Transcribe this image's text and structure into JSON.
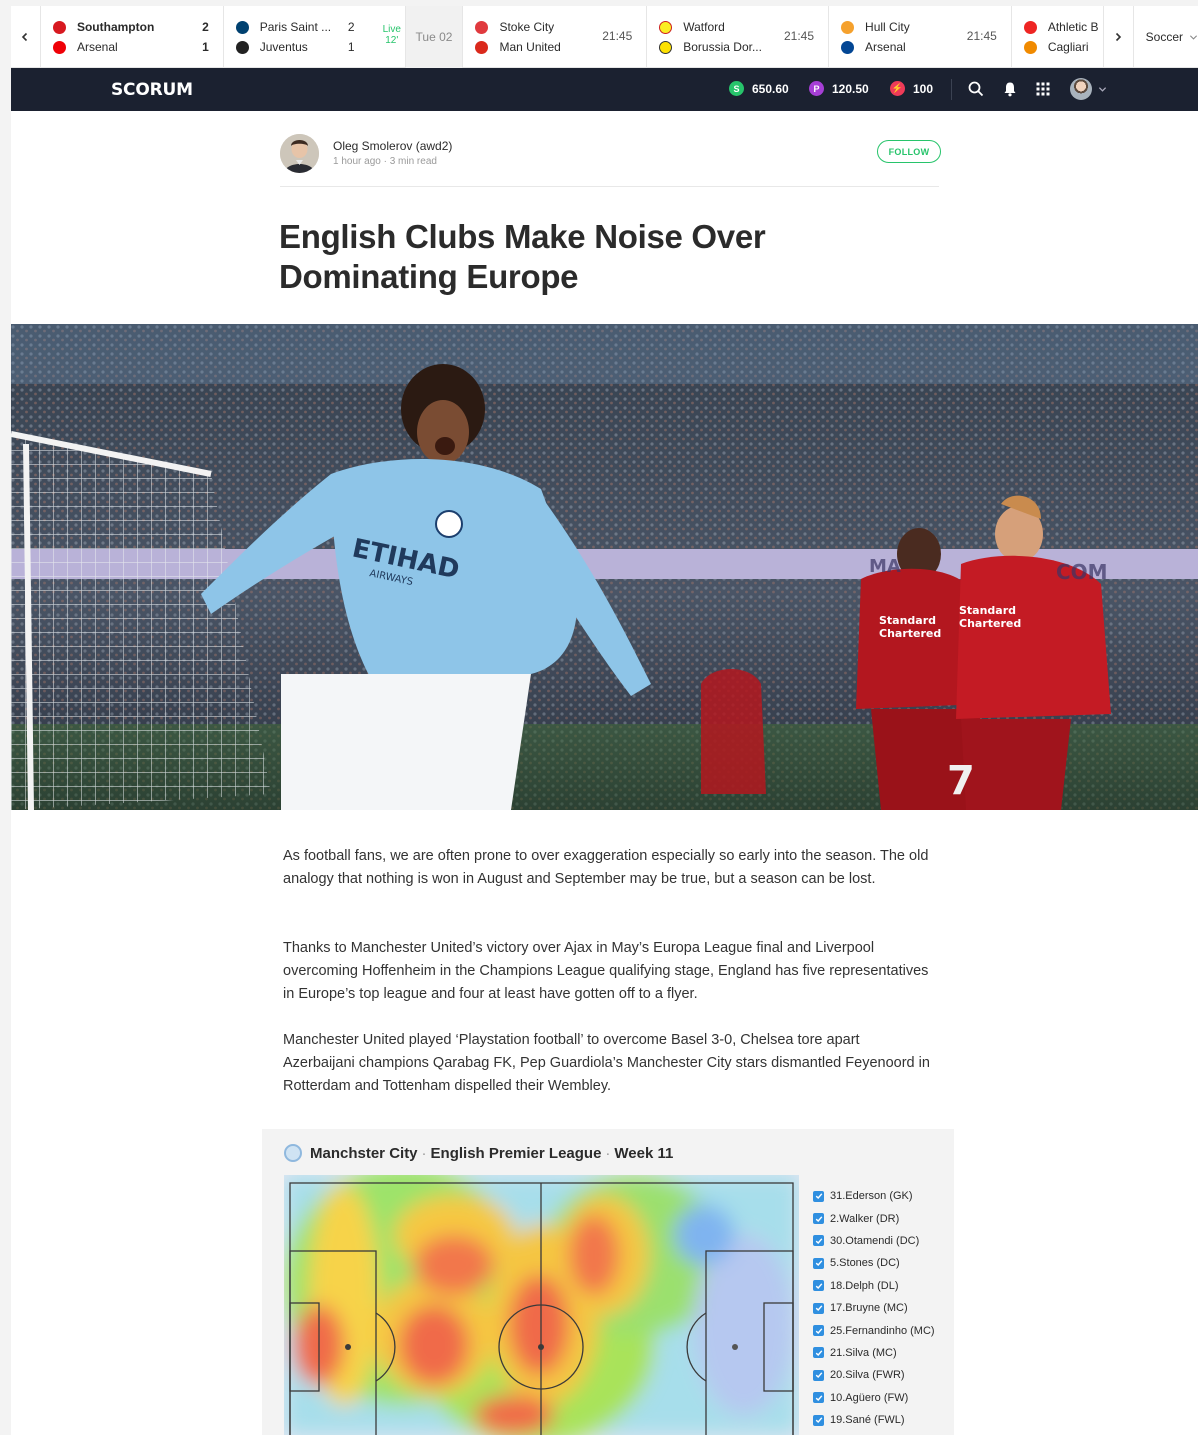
{
  "scores": {
    "matches": [
      {
        "home": "Southampton",
        "away": "Arsenal",
        "home_score": "2",
        "away_score": "1",
        "home_color": "#d71920",
        "away_color": "#ef0107"
      },
      {
        "home": "Paris Saint ...",
        "away": "Juventus",
        "home_score": "2",
        "away_score": "1",
        "home_color": "#004170",
        "away_color": "#222222",
        "status_line1": "Live",
        "status_line2": "12'"
      },
      {
        "home": "Stoke City",
        "away": "Man United",
        "time": "21:45",
        "home_color": "#e03a3e",
        "away_color": "#da291c"
      },
      {
        "home": "Watford",
        "away": "Borussia Dor...",
        "time": "21:45",
        "home_color": "#fbee23",
        "away_color": "#fde100"
      },
      {
        "home": "Hull City",
        "away": "Arsenal",
        "time": "21:45",
        "home_color": "#f5a12d",
        "away_color": "#034694"
      },
      {
        "home": "Athletic B",
        "away": "Cagliari",
        "home_color": "#ee2523",
        "away_color": "#f08a00"
      }
    ],
    "date_label": "Tue 02",
    "sport": "Soccer"
  },
  "nav": {
    "logo": "SCORUM",
    "balances": [
      {
        "icon": "S",
        "value": "650.60",
        "color": "#27c46b"
      },
      {
        "icon": "P",
        "value": "120.50",
        "color": "#a63fd6"
      },
      {
        "icon": "⚡",
        "value": "100",
        "color": "#ef3b58"
      }
    ]
  },
  "article": {
    "author": "Oleg Smolerov (awd2)",
    "meta": "1 hour ago · 3 min read",
    "follow": "FOLLOW",
    "title": "English Clubs Make Noise Over Dominating Europe",
    "paragraphs": [
      "As football fans, we are often prone to over exaggeration especially so early into the season. The old analogy that nothing is won in August and September may be true, but a season can be lost.",
      "Thanks to Manchester United’s victory over Ajax in May’s Europa League final and Liverpool overcoming Hoffenheim in the Champions League qualifying stage, England has five representatives in Europe’s top league and four at least have gotten off to a flyer.",
      "Manchester United played ‘Playstation football’ to overcome Basel 3-0, Chelsea tore apart Azerbaijani champions Qarabag FK, Pep Guardiola’s Manchester City stars dismantled Feyenoord in Rotterdam and Tottenham dispelled their Wembley."
    ]
  },
  "widget": {
    "team": "Manchster City",
    "league": "English Premier League",
    "week": "Week 11",
    "players": [
      "31.Ederson (GK)",
      "2.Walker (DR)",
      "30.Otamendi (DC)",
      "5.Stones (DC)",
      "18.Delph (DL)",
      "17.Bruyne (MC)",
      "25.Fernandinho (MC)",
      "21.Silva (MC)",
      "20.Silva (FWR)",
      "10.Agüero (FW)",
      "19.Sané (FWL)"
    ]
  }
}
